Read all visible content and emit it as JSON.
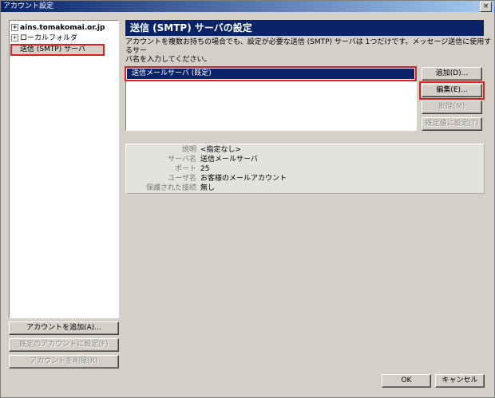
{
  "window": {
    "title": "アカウント設定",
    "close_label": "×"
  },
  "tree": {
    "items": [
      {
        "label": "ains.tomakomai.or.jp",
        "expander": "+"
      },
      {
        "label": "ローカルフォルダ",
        "expander": "+"
      },
      {
        "label": "送信 (SMTP) サーバ"
      }
    ]
  },
  "left_buttons": {
    "add_account": "アカウントを追加(A)...",
    "set_default": "既定のアカウントに設定(F)",
    "delete_account": "アカウントを削除(R)"
  },
  "panel": {
    "header": "送信 (SMTP) サーバの設定",
    "description_line1": "アカウントを複数お持ちの場合でも、設定が必要な送信 (SMTP) サーバは 1つだけです。メッセージ送信に使用するサー",
    "description_line2": "バ名を入力してください。",
    "server_list": [
      {
        "label": "送信メールサーバ  (既定)"
      }
    ]
  },
  "server_buttons": {
    "add": "追加(D)...",
    "edit": "編集(E)...",
    "delete": "削除(M)",
    "set_default": "既定値に設定(T)"
  },
  "details": [
    {
      "label": "説明",
      "value": "<指定なし>"
    },
    {
      "label": "サーバ名",
      "value": "送信メールサーバ"
    },
    {
      "label": "ポート",
      "value": "25"
    },
    {
      "label": "ユーザ名",
      "value": "お客様のメールアカウント"
    },
    {
      "label": "保護された接続",
      "value": "無し"
    }
  ],
  "footer": {
    "ok": "OK",
    "cancel": "キャンセル"
  }
}
